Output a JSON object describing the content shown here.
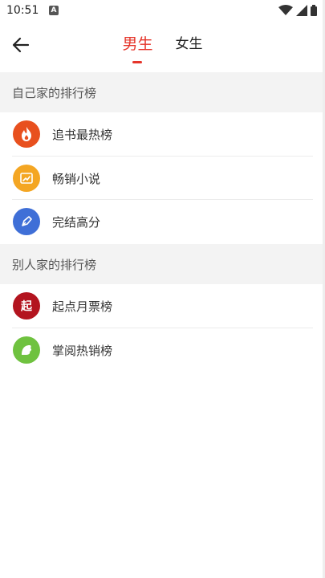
{
  "status": {
    "time": "10:51",
    "badge": "A"
  },
  "header": {
    "tabs": [
      {
        "label": "男生",
        "active": true
      },
      {
        "label": "女生",
        "active": false
      }
    ]
  },
  "sections": [
    {
      "title": "自己家的排行榜",
      "items": [
        {
          "label": "追书最热榜",
          "icon": "flame-icon",
          "color": "#e8501e"
        },
        {
          "label": "畅销小说",
          "icon": "chart-icon",
          "color": "#f4a623"
        },
        {
          "label": "完结高分",
          "icon": "pen-icon",
          "color": "#3f6fd7"
        }
      ]
    },
    {
      "title": "别人家的排行榜",
      "items": [
        {
          "label": "起点月票榜",
          "icon": "qidian-icon",
          "icon_text": "起",
          "color": "#b3141f"
        },
        {
          "label": "掌阅热销榜",
          "icon": "leaf-icon",
          "color": "#6fc23f"
        }
      ]
    }
  ]
}
